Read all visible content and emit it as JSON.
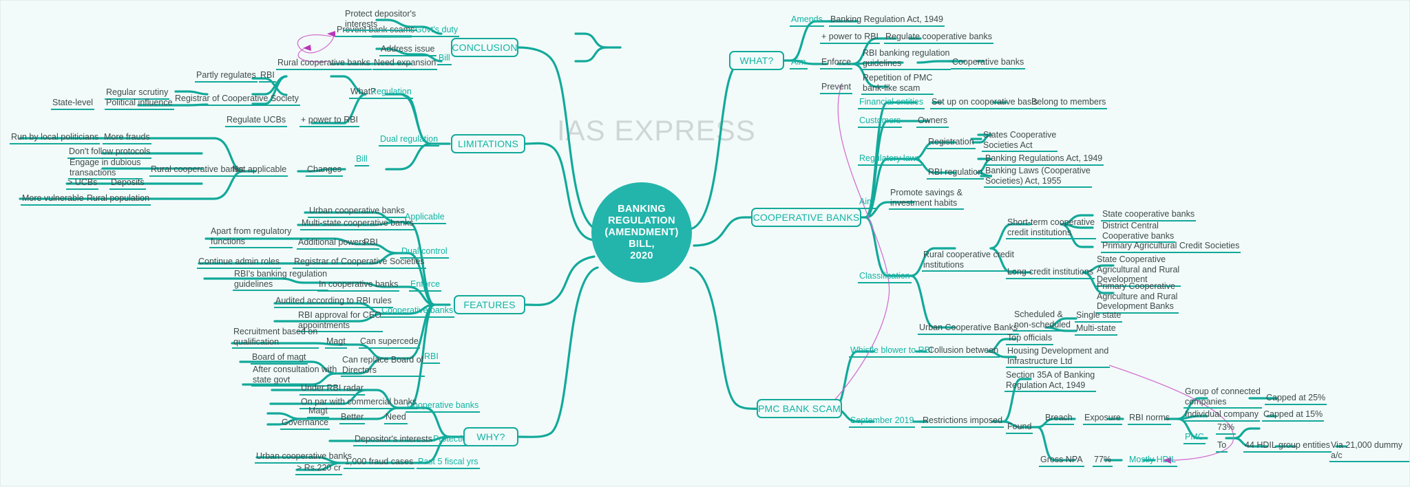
{
  "watermark": "IAS EXPRESS",
  "colors": {
    "accent": "#12b3a3",
    "branch": "#12a99a",
    "root_fill": "#23b5ab",
    "text": "#3e4a4a",
    "background": "#f2fbfa",
    "relation_line": "#d46fd0"
  },
  "root": {
    "title": "BANKING\nREGULATION\n(AMENDMENT) BILL,\n2020"
  },
  "main_branches": [
    {
      "id": "conclusion",
      "label": "CONCLUSION"
    },
    {
      "id": "limitations",
      "label": "LIMITATIONS"
    },
    {
      "id": "features",
      "label": "FEATURES"
    },
    {
      "id": "why",
      "label": "WHY?"
    },
    {
      "id": "what",
      "label": "WHAT?"
    },
    {
      "id": "cooperative_banks",
      "label": "COOPERATIVE BANKS"
    },
    {
      "id": "pmc_bank_scam",
      "label": "PMC BANK SCAM"
    }
  ],
  "nodes": {
    "conclusion": {
      "govts_duty": "Govt's duty",
      "prevent_bank_scams": "Prevent bank scams",
      "protect_depositors_interests": "Protect depositor's\ninterests",
      "bill": "Bill",
      "need_expansion": "Need expansion",
      "address_issue": "Address issue",
      "rural_cooperative_banks": "Rural cooperative banks"
    },
    "limitations": {
      "regulation": "Regulation",
      "what": "What?",
      "rbi": "RBI",
      "partly_regulates": "Partly regulates",
      "registrar_of_cooperative_society": "Registrar of Cooperative Society",
      "regular_scrutiny": "Regular scrutiny",
      "political_influence": "Political influence",
      "state_level": "State-level",
      "dual_regulation": "Dual regulation",
      "power_to_rbi": "+ power to RBI",
      "regulate_ucbs": "Regulate UCBs",
      "bill": "Bill",
      "changes": "Changes",
      "not_applicable": "Not applicable",
      "rural_cooperative_banks": "Rural cooperative banks",
      "more_frauds": "More frauds",
      "run_by_local_politicians": "Run by local politicians",
      "dont_follow_protocols": "Don't follow protocols",
      "engage_in_dubious_transactions": "Engage in dubious\ntransactions",
      "deposits": "Deposits",
      "gt_ucbs": "> UCBs",
      "rural_population": "Rural population",
      "more_vulnerable": "More vulnerable"
    },
    "features": {
      "dual_control": "Dual control",
      "applicable": "Applicable",
      "urban_cooperative_banks": "Urban cooperative banks",
      "multi_state_cooperative_banks": "Multi-state cooperative banks",
      "rbi": "RBI",
      "additional_powers": "Additional powers",
      "apart_from_regulatory_functions": "Apart from regulatory\nfunctions",
      "registrar_of_cooperative_societies": "Registrar of Cooperative Societies",
      "continue_admin_roles": "Continue admin roles",
      "enforce": "Enforce",
      "in_cooperative_banks": "In cooperative banks",
      "rbis_banking_regulation_guidelines": "RBI's banking regulation\nguidelines",
      "cooperative_banks": "Cooperative banks",
      "audited_according_to_rbi_rules": "Audited according to RBI rules",
      "rbi_approval_for_ceo_appointments": "RBI approval for CEO\nappointments",
      "rbi2": "RBI",
      "can_supercede": "Can supercede",
      "magt": "Magt",
      "recruitment_based_on_qualification": "Recruitment based on\nqualification",
      "can_replace_board_of_directors": "Can replace Board of\nDirectors",
      "board_of_magt": "Board of magt",
      "after_consultation_with_state_govt": "After consultation with\nstate govt"
    },
    "why": {
      "cooperative_banks": "Cooperative banks",
      "under_rbi_radar": "Under RBI radar",
      "need": "Need",
      "on_par_with_commercial_banks": "On par with commercial banks",
      "better": "Better",
      "magt": "Magt",
      "governance": "Governance",
      "protection": "Protection",
      "depositors_interests": "Depositor's interests",
      "past_5_fiscal_yrs": "Past 5 fiscal yrs",
      "fraud_cases": "1,000 fraud cases",
      "urban_cooperative_banks": "Urban cooperative banks",
      "gt_rs_220_cr": "> Rs.220 cr"
    },
    "what": {
      "amends": "Amends",
      "banking_regulation_act_1949": "Banking Regulation Act, 1949",
      "aim": "Aim",
      "power_to_rbi": "+ power to RBI",
      "regulate_cooperative_banks": "Regulate cooperative banks",
      "enforce": "Enforce",
      "rbi_banking_regulation_guidelines": "RBI banking regulation\nguidelines",
      "cooperative_banks": "Cooperative banks",
      "prevent": "Prevent",
      "repetition_of_pmc_bank_like_scam": "Repetition of PMC\nbank-like scam"
    },
    "cooperative_banks": {
      "financial_entities": "Financial entities",
      "set_up_on_cooperative_basis": "Set up on cooperative basis",
      "belong_to_members": "Belong to members",
      "customers": "Customers",
      "owners": "Owners",
      "regulatory_laws": "Regulatory laws",
      "registration": "Registration",
      "states_cooperative_societies_act": "States Cooperative\nSocieties Act",
      "rbi_regulation": "RBI regulation",
      "banking_regulations_act_1949": "Banking Regulations Act, 1949",
      "banking_laws_cooperative_societies_act_1955": "Banking Laws (Cooperative\nSocieties) Act, 1955",
      "aim": "Aim",
      "promote_savings_investment_habits": "Promote savings &\ninvestment habits",
      "classification": "Classification",
      "rural_cooperative_credit_institutions": "Rural cooperative credit\ninstitutions",
      "short_term_cooperative_credit_institutions": "Short-term cooperative\ncredit institutions",
      "state_cooperative_banks": "State cooperative banks",
      "district_central_cooperative_banks": "District Central\nCooperative banks",
      "primary_agricultural_credit_societies": "Primary Agricultural Credit Societies",
      "long_credit_institutions": "Long-credit institutions",
      "state_cooperative_agricultural_and_rural_development": "State Cooperative\nAgricultural and Rural\nDevelopment",
      "primary_cooperative_agriculture_and_rural_development_banks": "Primary Cooperative\nAgriculture and Rural\nDevelopment Banks",
      "urban_cooperative_banks": "Urban Cooperative Banks",
      "scheduled_non_scheduled": "Scheduled &\nnon-scheduled",
      "single_state": "Single state",
      "multi_state": "Multi-state"
    },
    "pmc_bank_scam": {
      "whistle_blower_to_rbi": "Whistle blower to RBI",
      "collusion_between": "Collusion between",
      "top_officials": "Top officials",
      "housing_development_and_infrastructure_ltd": "Housing Development and\nInfrastructure Ltd",
      "september_2019": "September 2019",
      "restrictions_imposed": "Restrictions imposed",
      "section_35a_of_banking_regulation_act_1949": "Section 35A of Banking\nRegulation Act, 1949",
      "found": "Found",
      "breach": "Breach",
      "exposure": "Exposure",
      "rbi_norms": "RBI norms",
      "group_of_connected_companies": "Group of connected\ncompanies",
      "capped_at_25": "Capped at 25%",
      "individual_company": "Individual company",
      "capped_at_15": "Capped at 15%",
      "pmc": "PMC",
      "pct_73": "73%",
      "to": "To",
      "hdil_group_entities": "44 HDIL group entities",
      "via_dummy_ac": "Via 21,000 dummy a/c",
      "gross_npa": "Gross NPA",
      "pct_77": "77%",
      "mostly_hdil": "Mostly HDIL"
    }
  }
}
